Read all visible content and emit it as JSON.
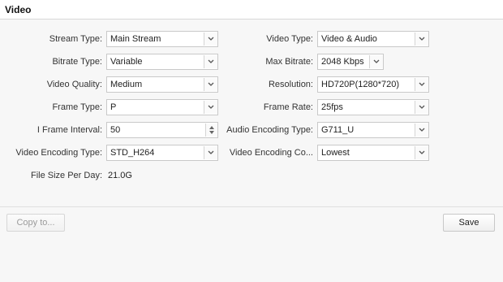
{
  "section": {
    "title": "Video"
  },
  "fields": {
    "stream_type": {
      "label": "Stream Type:",
      "value": "Main Stream"
    },
    "bitrate_type": {
      "label": "Bitrate Type:",
      "value": "Variable"
    },
    "video_quality": {
      "label": "Video Quality:",
      "value": "Medium"
    },
    "frame_type": {
      "label": "Frame Type:",
      "value": "P"
    },
    "i_frame_interval": {
      "label": "I Frame Interval:",
      "value": "50"
    },
    "video_encoding_type": {
      "label": "Video Encoding Type:",
      "value": "STD_H264"
    },
    "file_size_per_day": {
      "label": "File Size Per Day:",
      "value": "21.0G"
    },
    "video_type": {
      "label": "Video Type:",
      "value": "Video & Audio"
    },
    "max_bitrate": {
      "label": "Max Bitrate:",
      "value": "2048 Kbps"
    },
    "resolution": {
      "label": "Resolution:",
      "value": "HD720P(1280*720)"
    },
    "frame_rate": {
      "label": "Frame Rate:",
      "value": "25fps"
    },
    "audio_encoding_type": {
      "label": "Audio Encoding Type:",
      "value": "G711_U"
    },
    "video_encoding_complexity": {
      "label": "Video Encoding Co...",
      "value": "Lowest"
    }
  },
  "buttons": {
    "copy_to": "Copy to...",
    "save": "Save"
  },
  "icons": {
    "dropdown": "chevron-down-icon",
    "spinner": "spinner-icon"
  }
}
